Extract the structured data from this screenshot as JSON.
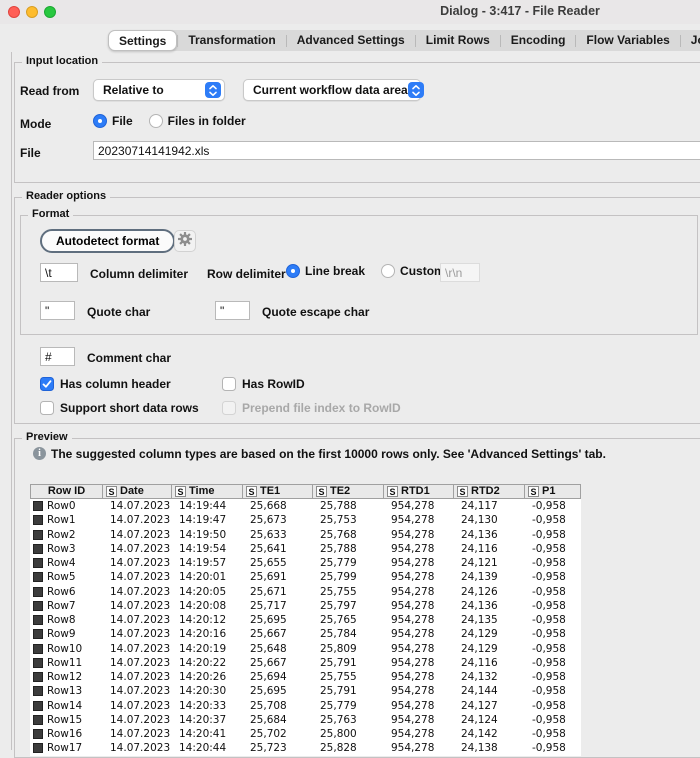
{
  "window": {
    "title": "Dialog - 3:417 - File Reader"
  },
  "tabs": [
    {
      "label": "Settings",
      "selected": true
    },
    {
      "label": "Transformation",
      "selected": false
    },
    {
      "label": "Advanced Settings",
      "selected": false
    },
    {
      "label": "Limit Rows",
      "selected": false
    },
    {
      "label": "Encoding",
      "selected": false
    },
    {
      "label": "Flow Variables",
      "selected": false
    },
    {
      "label": "Job Manager Selection",
      "selected": false
    }
  ],
  "input_location": {
    "group_title": "Input location",
    "read_from_label": "Read from",
    "read_from_value": "Relative to",
    "location_value": "Current workflow data area",
    "mode_label": "Mode",
    "mode_options": [
      {
        "label": "File",
        "selected": true
      },
      {
        "label": "Files in folder",
        "selected": false
      }
    ],
    "file_label": "File",
    "file_value": "20230714141942.xls"
  },
  "reader_options": {
    "group_title": "Reader options",
    "format": {
      "group_title": "Format",
      "autodetect_button": "Autodetect format",
      "gear_icon": "gear-icon",
      "column_delimiter_value": "\\t",
      "column_delimiter_label": "Column delimiter",
      "row_delimiter_label": "Row delimiter",
      "row_delimiter_options": [
        {
          "label": "Line break",
          "selected": true
        },
        {
          "label": "Custom",
          "selected": false
        }
      ],
      "custom_row_delimiter_value": "\\r\\n",
      "quote_char_value": "\"",
      "quote_char_label": "Quote char",
      "quote_escape_value": "\"",
      "quote_escape_label": "Quote escape char"
    },
    "comment_char_value": "#",
    "comment_char_label": "Comment char",
    "checkboxes": [
      {
        "label": "Has column header",
        "checked": true,
        "enabled": true
      },
      {
        "label": "Has RowID",
        "checked": false,
        "enabled": true
      },
      {
        "label": "Support short data rows",
        "checked": false,
        "enabled": true
      },
      {
        "label": "Prepend file index to RowID",
        "checked": false,
        "enabled": false
      }
    ]
  },
  "preview": {
    "group_title": "Preview",
    "info_text": "The suggested column types are based on the first 10000 rows only. See 'Advanced Settings' tab.",
    "table": {
      "columns": [
        {
          "name": "Row ID",
          "type": ""
        },
        {
          "name": "Date",
          "type": "S"
        },
        {
          "name": "Time",
          "type": "S"
        },
        {
          "name": "TE1",
          "type": "S"
        },
        {
          "name": "TE2",
          "type": "S"
        },
        {
          "name": "RTD1",
          "type": "S"
        },
        {
          "name": "RTD2",
          "type": "S"
        },
        {
          "name": "P1",
          "type": "S"
        }
      ],
      "rows": [
        [
          "Row0",
          "14.07.2023",
          "14:19:44",
          "25,668",
          "25,788",
          "954,278",
          "24,117",
          "-0,958"
        ],
        [
          "Row1",
          "14.07.2023",
          "14:19:47",
          "25,673",
          "25,753",
          "954,278",
          "24,130",
          "-0,958"
        ],
        [
          "Row2",
          "14.07.2023",
          "14:19:50",
          "25,633",
          "25,768",
          "954,278",
          "24,136",
          "-0,958"
        ],
        [
          "Row3",
          "14.07.2023",
          "14:19:54",
          "25,641",
          "25,788",
          "954,278",
          "24,116",
          "-0,958"
        ],
        [
          "Row4",
          "14.07.2023",
          "14:19:57",
          "25,655",
          "25,779",
          "954,278",
          "24,121",
          "-0,958"
        ],
        [
          "Row5",
          "14.07.2023",
          "14:20:01",
          "25,691",
          "25,799",
          "954,278",
          "24,139",
          "-0,958"
        ],
        [
          "Row6",
          "14.07.2023",
          "14:20:05",
          "25,671",
          "25,755",
          "954,278",
          "24,126",
          "-0,958"
        ],
        [
          "Row7",
          "14.07.2023",
          "14:20:08",
          "25,717",
          "25,797",
          "954,278",
          "24,136",
          "-0,958"
        ],
        [
          "Row8",
          "14.07.2023",
          "14:20:12",
          "25,695",
          "25,765",
          "954,278",
          "24,135",
          "-0,958"
        ],
        [
          "Row9",
          "14.07.2023",
          "14:20:16",
          "25,667",
          "25,784",
          "954,278",
          "24,129",
          "-0,958"
        ],
        [
          "Row10",
          "14.07.2023",
          "14:20:19",
          "25,648",
          "25,809",
          "954,278",
          "24,129",
          "-0,958"
        ],
        [
          "Row11",
          "14.07.2023",
          "14:20:22",
          "25,667",
          "25,791",
          "954,278",
          "24,116",
          "-0,958"
        ],
        [
          "Row12",
          "14.07.2023",
          "14:20:26",
          "25,694",
          "25,755",
          "954,278",
          "24,132",
          "-0,958"
        ],
        [
          "Row13",
          "14.07.2023",
          "14:20:30",
          "25,695",
          "25,791",
          "954,278",
          "24,144",
          "-0,958"
        ],
        [
          "Row14",
          "14.07.2023",
          "14:20:33",
          "25,708",
          "25,779",
          "954,278",
          "24,127",
          "-0,958"
        ],
        [
          "Row15",
          "14.07.2023",
          "14:20:37",
          "25,684",
          "25,763",
          "954,278",
          "24,124",
          "-0,958"
        ],
        [
          "Row16",
          "14.07.2023",
          "14:20:41",
          "25,702",
          "25,800",
          "954,278",
          "24,142",
          "-0,958"
        ],
        [
          "Row17",
          "14.07.2023",
          "14:20:44",
          "25,723",
          "25,828",
          "954,278",
          "24,138",
          "-0,958"
        ]
      ]
    }
  },
  "colors": {
    "accent_blue": "#2d7cf7",
    "traffic_red": "#ff5f57",
    "traffic_yellow": "#febc2e",
    "traffic_green": "#28c840",
    "panel_bg": "#ececec",
    "row_swatch": "#3c3c3c"
  }
}
